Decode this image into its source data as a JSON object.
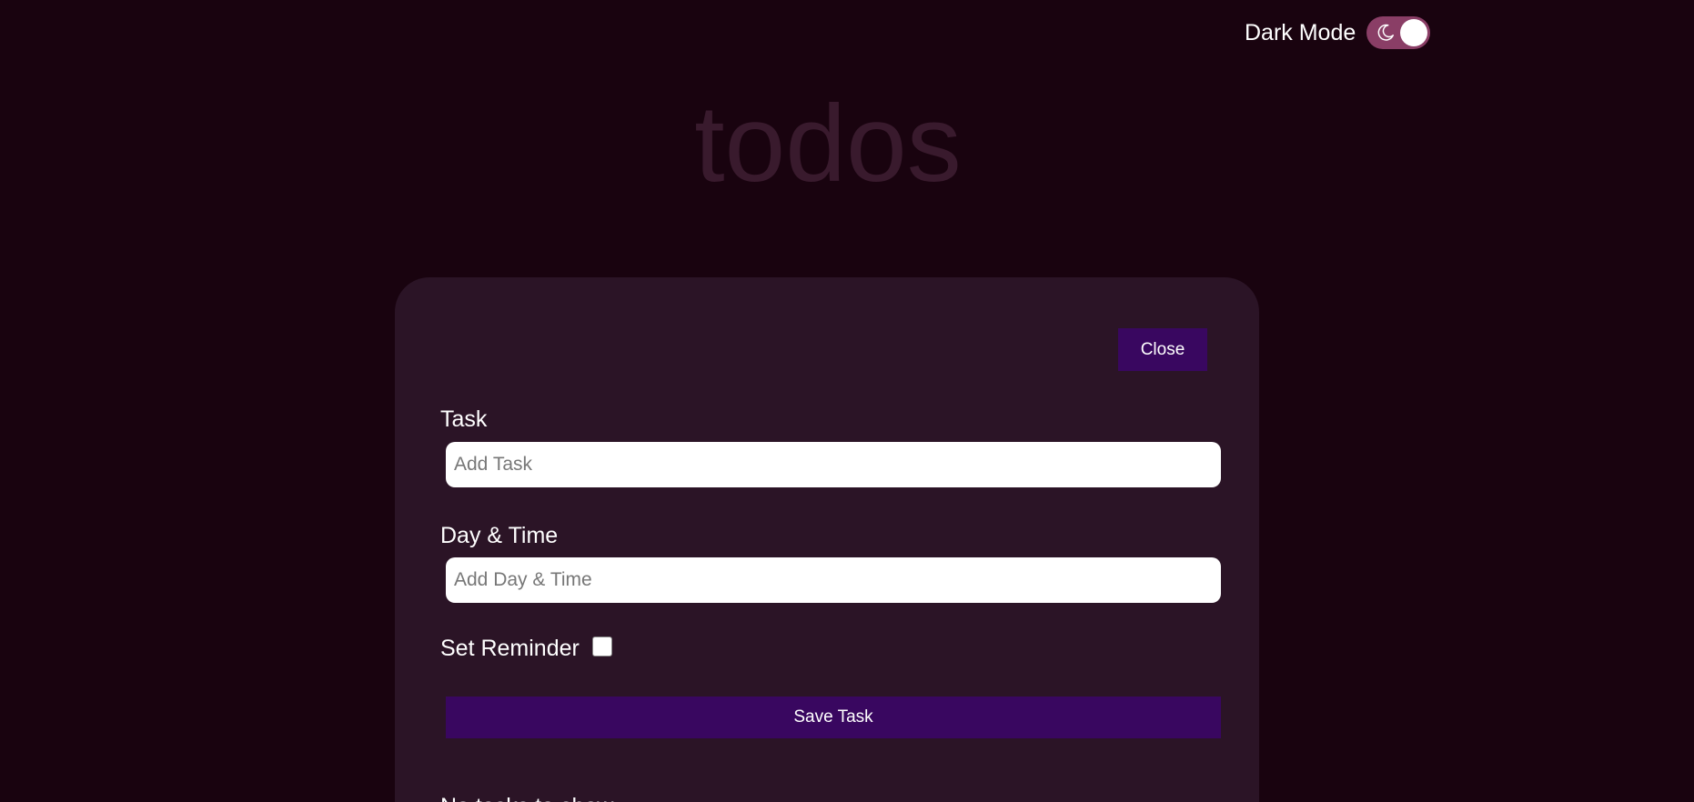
{
  "header": {
    "dark_mode_label": "Dark Mode",
    "dark_mode_enabled": true
  },
  "app": {
    "logo_text": "todos"
  },
  "form": {
    "close_label": "Close",
    "task_label": "Task",
    "task_placeholder": "Add Task",
    "task_value": "",
    "datetime_label": "Day & Time",
    "datetime_placeholder": "Add Day & Time",
    "datetime_value": "",
    "reminder_label": "Set Reminder",
    "reminder_checked": false,
    "save_label": "Save Task"
  },
  "list": {
    "partial_heading": "No tasks to show"
  },
  "colors": {
    "background": "#19030f",
    "card": "#2b1426",
    "accent_button": "#390760",
    "toggle_track": "#8a3e66",
    "logo": "#391a2d"
  },
  "icons": {
    "toggle_icon": "moon-icon"
  }
}
